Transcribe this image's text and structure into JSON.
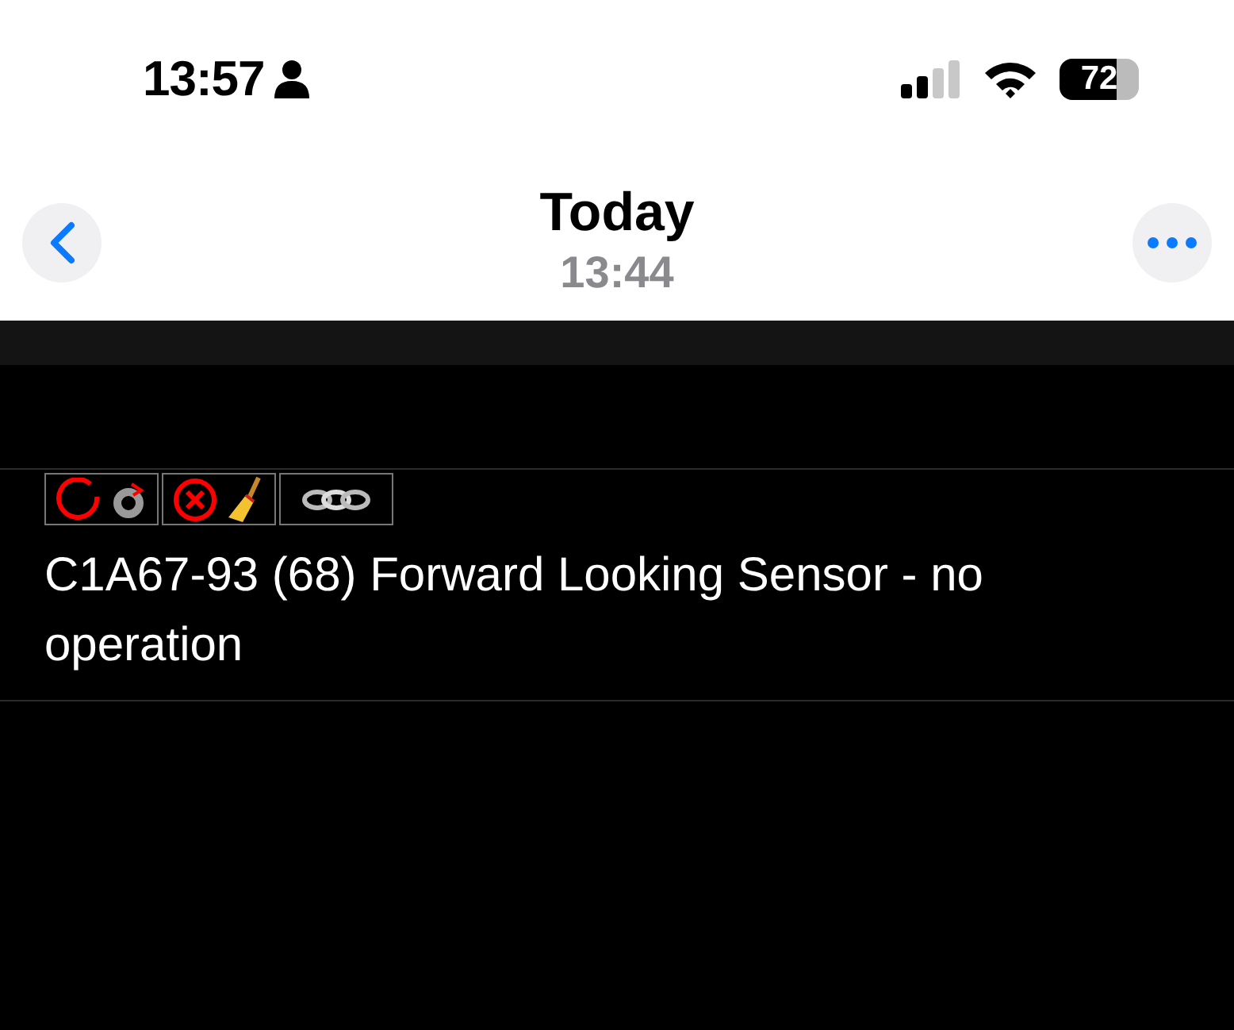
{
  "status_bar": {
    "time": "13:57",
    "battery": "72"
  },
  "nav": {
    "title": "Today",
    "subtitle": "13:44"
  },
  "message": {
    "text": "C1A67-93 (68) Forward Looking Sensor - no operation"
  }
}
